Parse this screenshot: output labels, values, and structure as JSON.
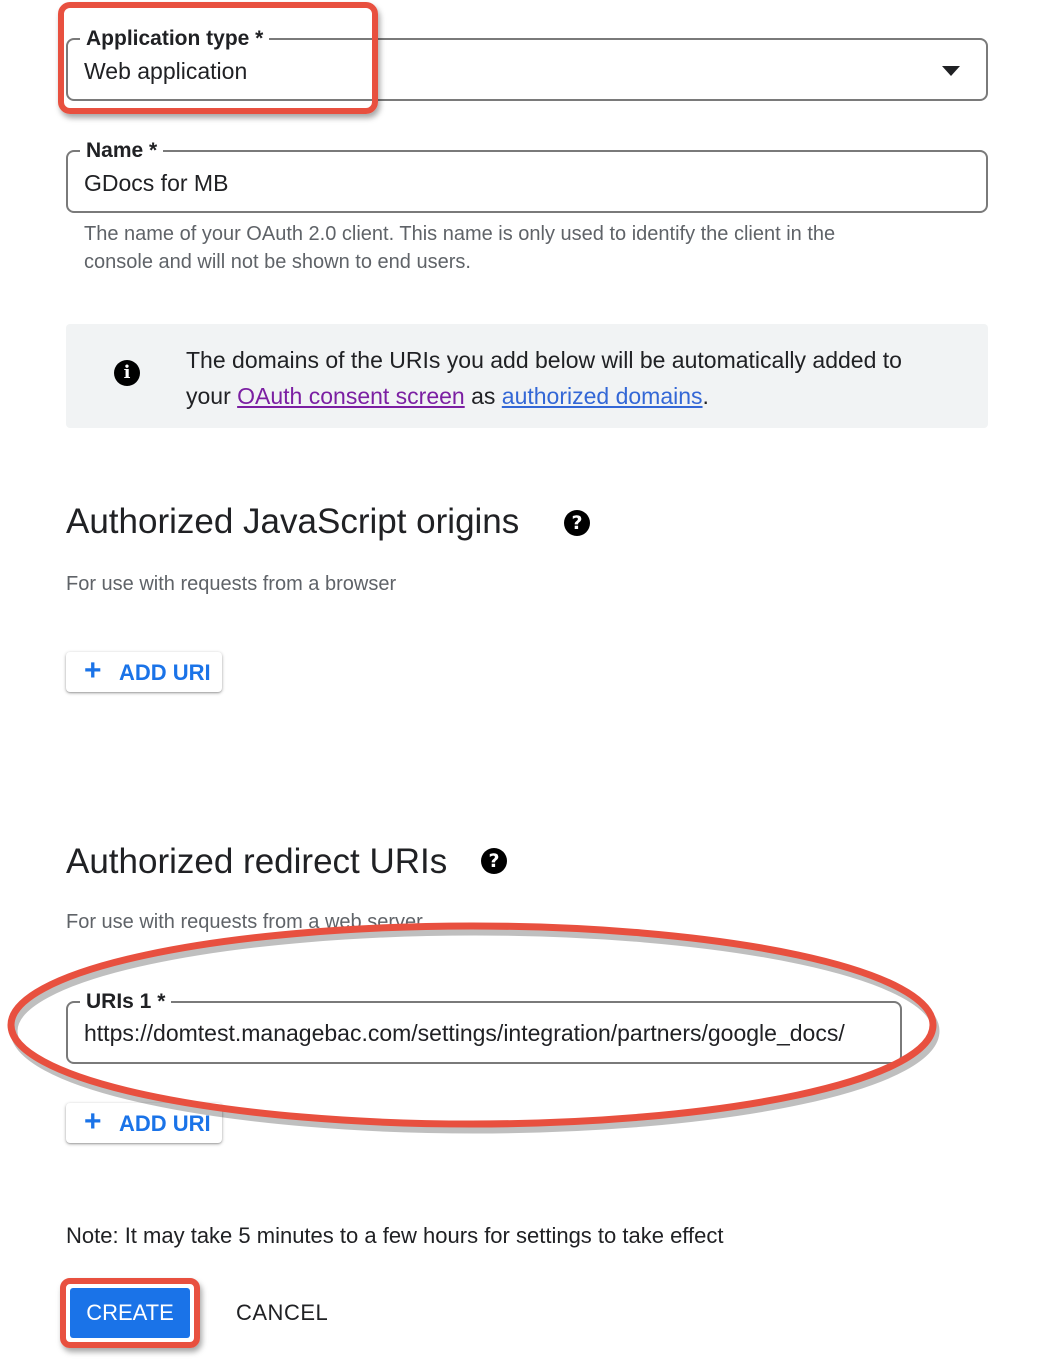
{
  "application_type": {
    "label": "Application type *",
    "value": "Web application"
  },
  "name_field": {
    "label": "Name *",
    "value": "GDocs for MB",
    "helper_line1": "The name of your OAuth 2.0 client. This name is only used to identify the client in the",
    "helper_line2": "console and will not be shown to end users."
  },
  "info_box": {
    "line1": "The domains of the URIs you add below will be automatically added to",
    "line2_prefix": "your ",
    "consent_link": "OAuth consent screen",
    "line2_middle": " as ",
    "domains_link": "authorized domains",
    "line2_suffix": "."
  },
  "js_origins": {
    "title": "Authorized JavaScript origins",
    "subtitle": "For use with requests from a browser",
    "add_button": "ADD URI"
  },
  "redirect_uris": {
    "title": "Authorized redirect URIs",
    "subtitle": "For use with requests from a web server",
    "uri_label": "URIs 1 *",
    "uri_value": "https://domtest.managebac.com/settings/integration/partners/google_docs/",
    "add_button": "ADD URI"
  },
  "note": "Note: It may take 5 minutes to a few hours for settings to take effect",
  "actions": {
    "create": "CREATE",
    "cancel": "CANCEL"
  },
  "colors": {
    "accent": "#1a73e8",
    "annotation": "#e8503f",
    "link_visited": "#7b1fa2"
  },
  "icons": {
    "info": "info-icon",
    "help": "help-icon",
    "dropdown": "dropdown-arrow-icon",
    "add": "plus-icon"
  }
}
